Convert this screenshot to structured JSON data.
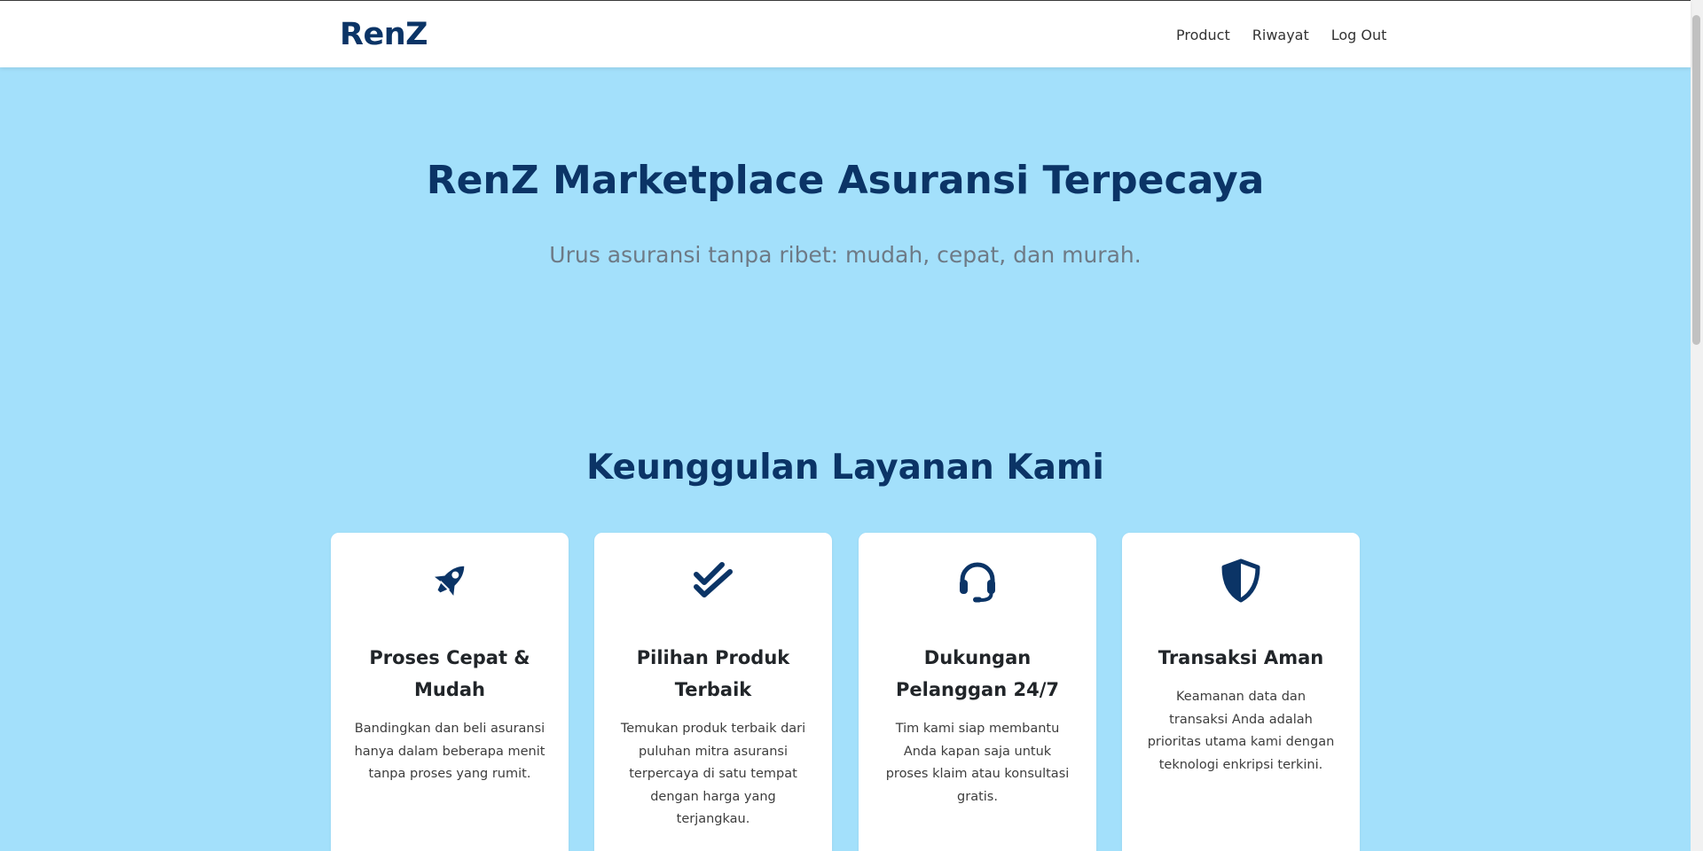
{
  "navbar": {
    "brand": "RenZ",
    "links": [
      "Product",
      "Riwayat",
      "Log Out"
    ]
  },
  "hero": {
    "title": "RenZ Marketplace Asuransi Terpecaya",
    "subtitle": "Urus asuransi tanpa ribet: mudah, cepat, dan murah."
  },
  "features": {
    "title": "Keunggulan Layanan Kami",
    "cards": [
      {
        "icon": "rocket-icon",
        "title": "Proses Cepat & Mudah",
        "text": "Bandingkan dan beli asuransi hanya dalam beberapa menit tanpa proses yang rumit."
      },
      {
        "icon": "double-check-icon",
        "title": "Pilihan Produk Terbaik",
        "text": "Temukan produk terbaik dari puluhan mitra asuransi terpercaya di satu tempat dengan harga yang terjangkau."
      },
      {
        "icon": "headset-icon",
        "title": "Dukungan Pelanggan 24/7",
        "text": "Tim kami siap membantu Anda kapan saja untuk proses klaim atau konsultasi gratis."
      },
      {
        "icon": "shield-icon",
        "title": "Transaksi Aman",
        "text": "Keamanan data dan transaksi Anda adalah prioritas utama kami dengan teknologi enkripsi terkini."
      }
    ]
  },
  "colors": {
    "primary": "#0b3466",
    "background": "#a3e0fb",
    "card": "#ffffff",
    "muted_text": "#6e7a86"
  }
}
